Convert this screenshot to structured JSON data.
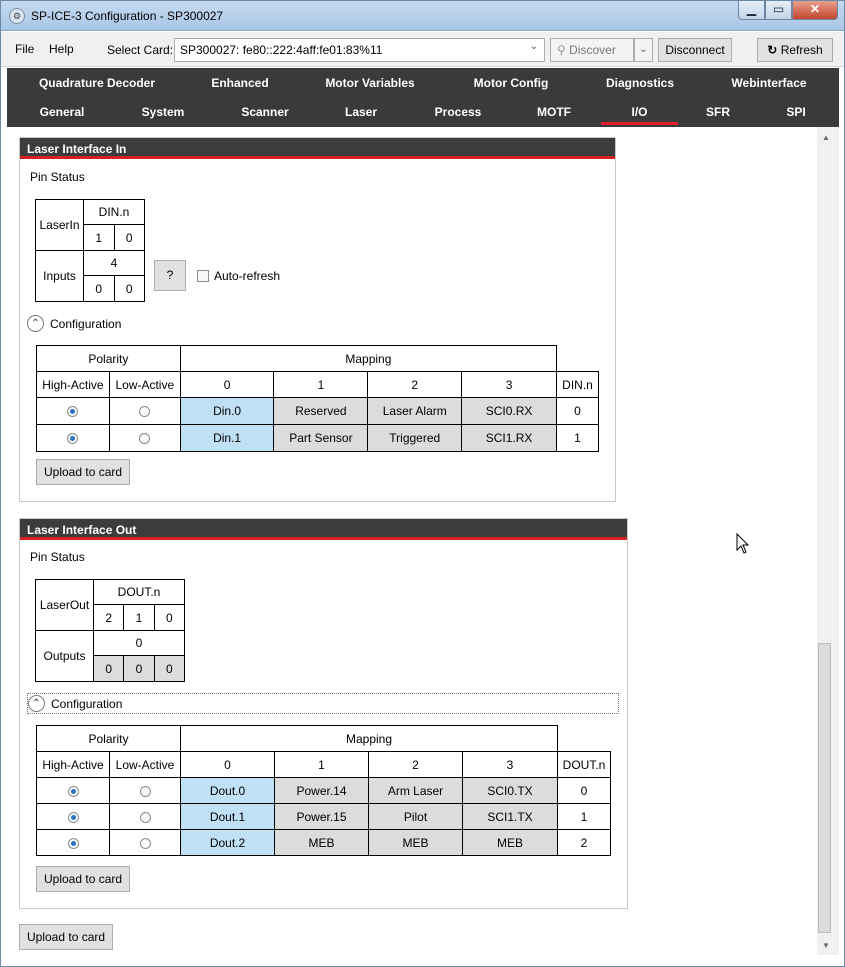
{
  "window": {
    "title": "SP-ICE-3 Configuration - SP300027",
    "minimize": "▁",
    "maximize": "▭",
    "close": "✕"
  },
  "menu": {
    "file": "File",
    "help": "Help"
  },
  "toolbar": {
    "select_card_label": "Select Card:",
    "select_card_value": "SP300027: fe80::222:4aff:fe01:83%11",
    "discover_label": "Discover",
    "disconnect_label": "Disconnect",
    "refresh_label": "Refresh"
  },
  "tabs": {
    "row1": [
      "Quadrature Decoder",
      "Enhanced",
      "Motor Variables",
      "Motor Config",
      "Diagnostics",
      "Webinterface"
    ],
    "row2": [
      "General",
      "System",
      "Scanner",
      "Laser",
      "Process",
      "MOTF",
      "I/O",
      "SFR",
      "SPI"
    ],
    "active": "I/O"
  },
  "laser_in": {
    "header": "Laser Interface In",
    "pin_status_label": "Pin Status",
    "pin_table": {
      "laserin_label": "LaserIn",
      "din_header": "DIN.n",
      "din_bits": [
        "1",
        "0"
      ],
      "inputs_label": "Inputs",
      "inputs_value": "4",
      "input_bits": [
        "0",
        "0"
      ]
    },
    "help_button": "?",
    "auto_refresh_label": "Auto-refresh",
    "config_label": "Configuration",
    "config_table": {
      "polarity_header": "Polarity",
      "mapping_header": "Mapping",
      "high_active": "High-Active",
      "low_active": "Low-Active",
      "map_cols": [
        "0",
        "1",
        "2",
        "3"
      ],
      "index_header": "DIN.n",
      "rows": [
        {
          "high": true,
          "map": [
            "Din.0",
            "Reserved",
            "Laser Alarm",
            "SCI0.RX"
          ],
          "index": "0"
        },
        {
          "high": true,
          "map": [
            "Din.1",
            "Part Sensor",
            "Triggered",
            "SCI1.RX"
          ],
          "index": "1"
        }
      ]
    },
    "upload_label": "Upload to card"
  },
  "laser_out": {
    "header": "Laser Interface Out",
    "pin_status_label": "Pin Status",
    "pin_table": {
      "laserout_label": "LaserOut",
      "dout_header": "DOUT.n",
      "dout_bits": [
        "2",
        "1",
        "0"
      ],
      "outputs_label": "Outputs",
      "outputs_value": "0",
      "output_bits": [
        "0",
        "0",
        "0"
      ]
    },
    "config_label": "Configuration",
    "config_table": {
      "polarity_header": "Polarity",
      "mapping_header": "Mapping",
      "high_active": "High-Active",
      "low_active": "Low-Active",
      "map_cols": [
        "0",
        "1",
        "2",
        "3"
      ],
      "index_header": "DOUT.n",
      "rows": [
        {
          "high": true,
          "map": [
            "Dout.0",
            "Power.14",
            "Arm Laser",
            "SCI0.TX"
          ],
          "index": "0"
        },
        {
          "high": true,
          "map": [
            "Dout.1",
            "Power.15",
            "Pilot",
            "SCI1.TX"
          ],
          "index": "1"
        },
        {
          "high": true,
          "map": [
            "Dout.2",
            "MEB",
            "MEB",
            "MEB"
          ],
          "index": "2"
        }
      ]
    },
    "upload_label": "Upload to card"
  },
  "global_upload_label": "Upload to card"
}
